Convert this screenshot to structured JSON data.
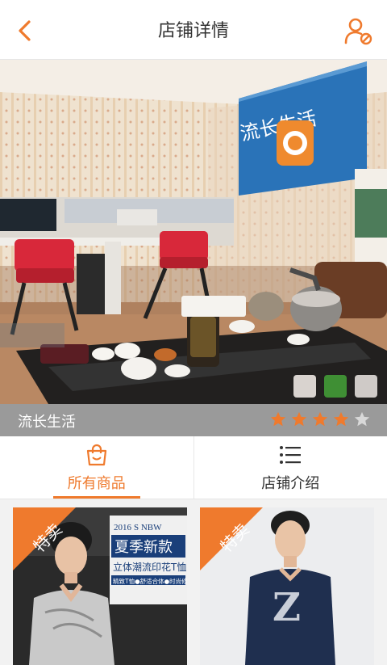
{
  "header": {
    "title": "店铺详情",
    "back_icon": "back-arrow-icon",
    "user_icon": "user-cancel-icon"
  },
  "banner": {
    "sign_text": "流长生活",
    "thumbnails": [
      "#d9d3cf",
      "#3f8f34",
      "#cfcac7"
    ]
  },
  "shop": {
    "name": "流长生活",
    "rating": 4,
    "max_rating": 5
  },
  "tabs": [
    {
      "label": "所有商品",
      "icon": "shopping-bag-icon",
      "active": true
    },
    {
      "label": "店铺介绍",
      "icon": "list-icon",
      "active": false
    }
  ],
  "products": [
    {
      "ribbon": "特卖",
      "poster_year": "2016",
      "poster_brand": "S  NBW",
      "poster_title": "夏季新款",
      "poster_sub": "立体潮流印花T恤",
      "poster_line": "精致T恤●舒适合体●时尚修身"
    },
    {
      "ribbon": "特卖"
    }
  ],
  "colors": {
    "accent": "#ef7a2d",
    "star_off": "#d8d8d8"
  }
}
